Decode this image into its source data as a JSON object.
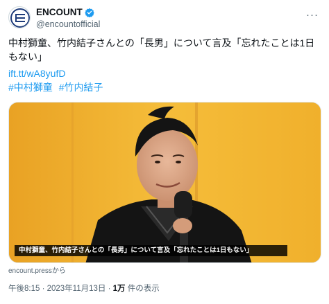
{
  "account": {
    "display_name": "ENCOUNT",
    "handle": "@encountofficial",
    "avatar_icon": "encount-logo-icon",
    "verified_icon": "verified-badge-icon",
    "verified_color": "#1d9bf0"
  },
  "more_icon_label": "···",
  "tweet": {
    "text": "中村獅童、竹内結子さんとの「長男」について言及「忘れたことは1日もない」",
    "link": "ift.tt/wA8yufD",
    "hashtags": [
      "#中村獅童",
      "#竹内結子"
    ],
    "media_caption": "中村獅童、竹内結子さんとの「長男」について言及「忘れたことは1日もない」",
    "source": "encount.pressから"
  },
  "meta": {
    "timestamp": "午後8:15 · 2023年11月13日",
    "separator": " · ",
    "views_count": "1万",
    "views_label": " 件の表示"
  },
  "colors": {
    "link": "#1d9bf0",
    "secondary_text": "#536471",
    "background_gold": "#f3b530"
  }
}
